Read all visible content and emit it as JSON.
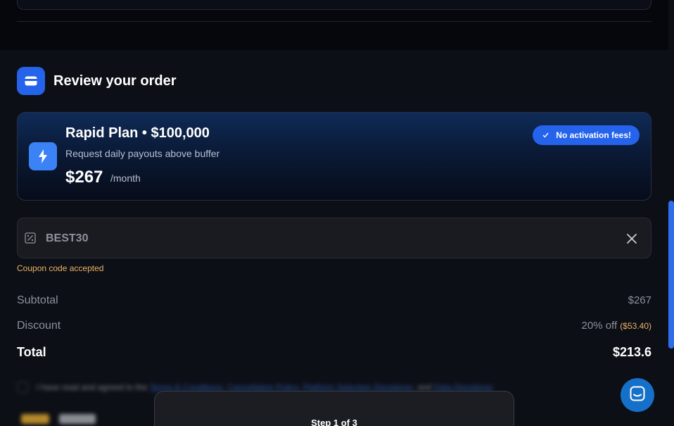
{
  "section": {
    "title": "Review your order",
    "icon": "card-icon"
  },
  "plan": {
    "title": "Rapid Plan • $100,000",
    "subtitle": "Request daily payouts above buffer",
    "price": "$267",
    "period": "/month",
    "badge": "No activation fees!",
    "badge_icon": "check-icon",
    "icon": "lightning-icon"
  },
  "coupon": {
    "value": "BEST30",
    "status": "Coupon code accepted",
    "icon": "coupon-icon",
    "clear_icon": "close-icon"
  },
  "summary": {
    "subtotal_label": "Subtotal",
    "subtotal_value": "$267",
    "discount_label": "Discount",
    "discount_value": "20% off",
    "discount_amount": "($53.40)",
    "total_label": "Total",
    "total_value": "$213.6"
  },
  "terms": {
    "prefix": "I have read and agreed to the",
    "link1": "Terms & Conditions",
    "link2": "Cancellation Policy",
    "link3": "Platform Selection Disclaimer",
    "mid": ", and",
    "link4": "Data Disclaimer"
  },
  "stepper": {
    "label": "Step 1 of 3"
  },
  "chat": {
    "icon": "chat-icon"
  },
  "colors": {
    "accent": "#2563eb",
    "coupon_status": "#eab266",
    "background": "#0d0f16"
  }
}
